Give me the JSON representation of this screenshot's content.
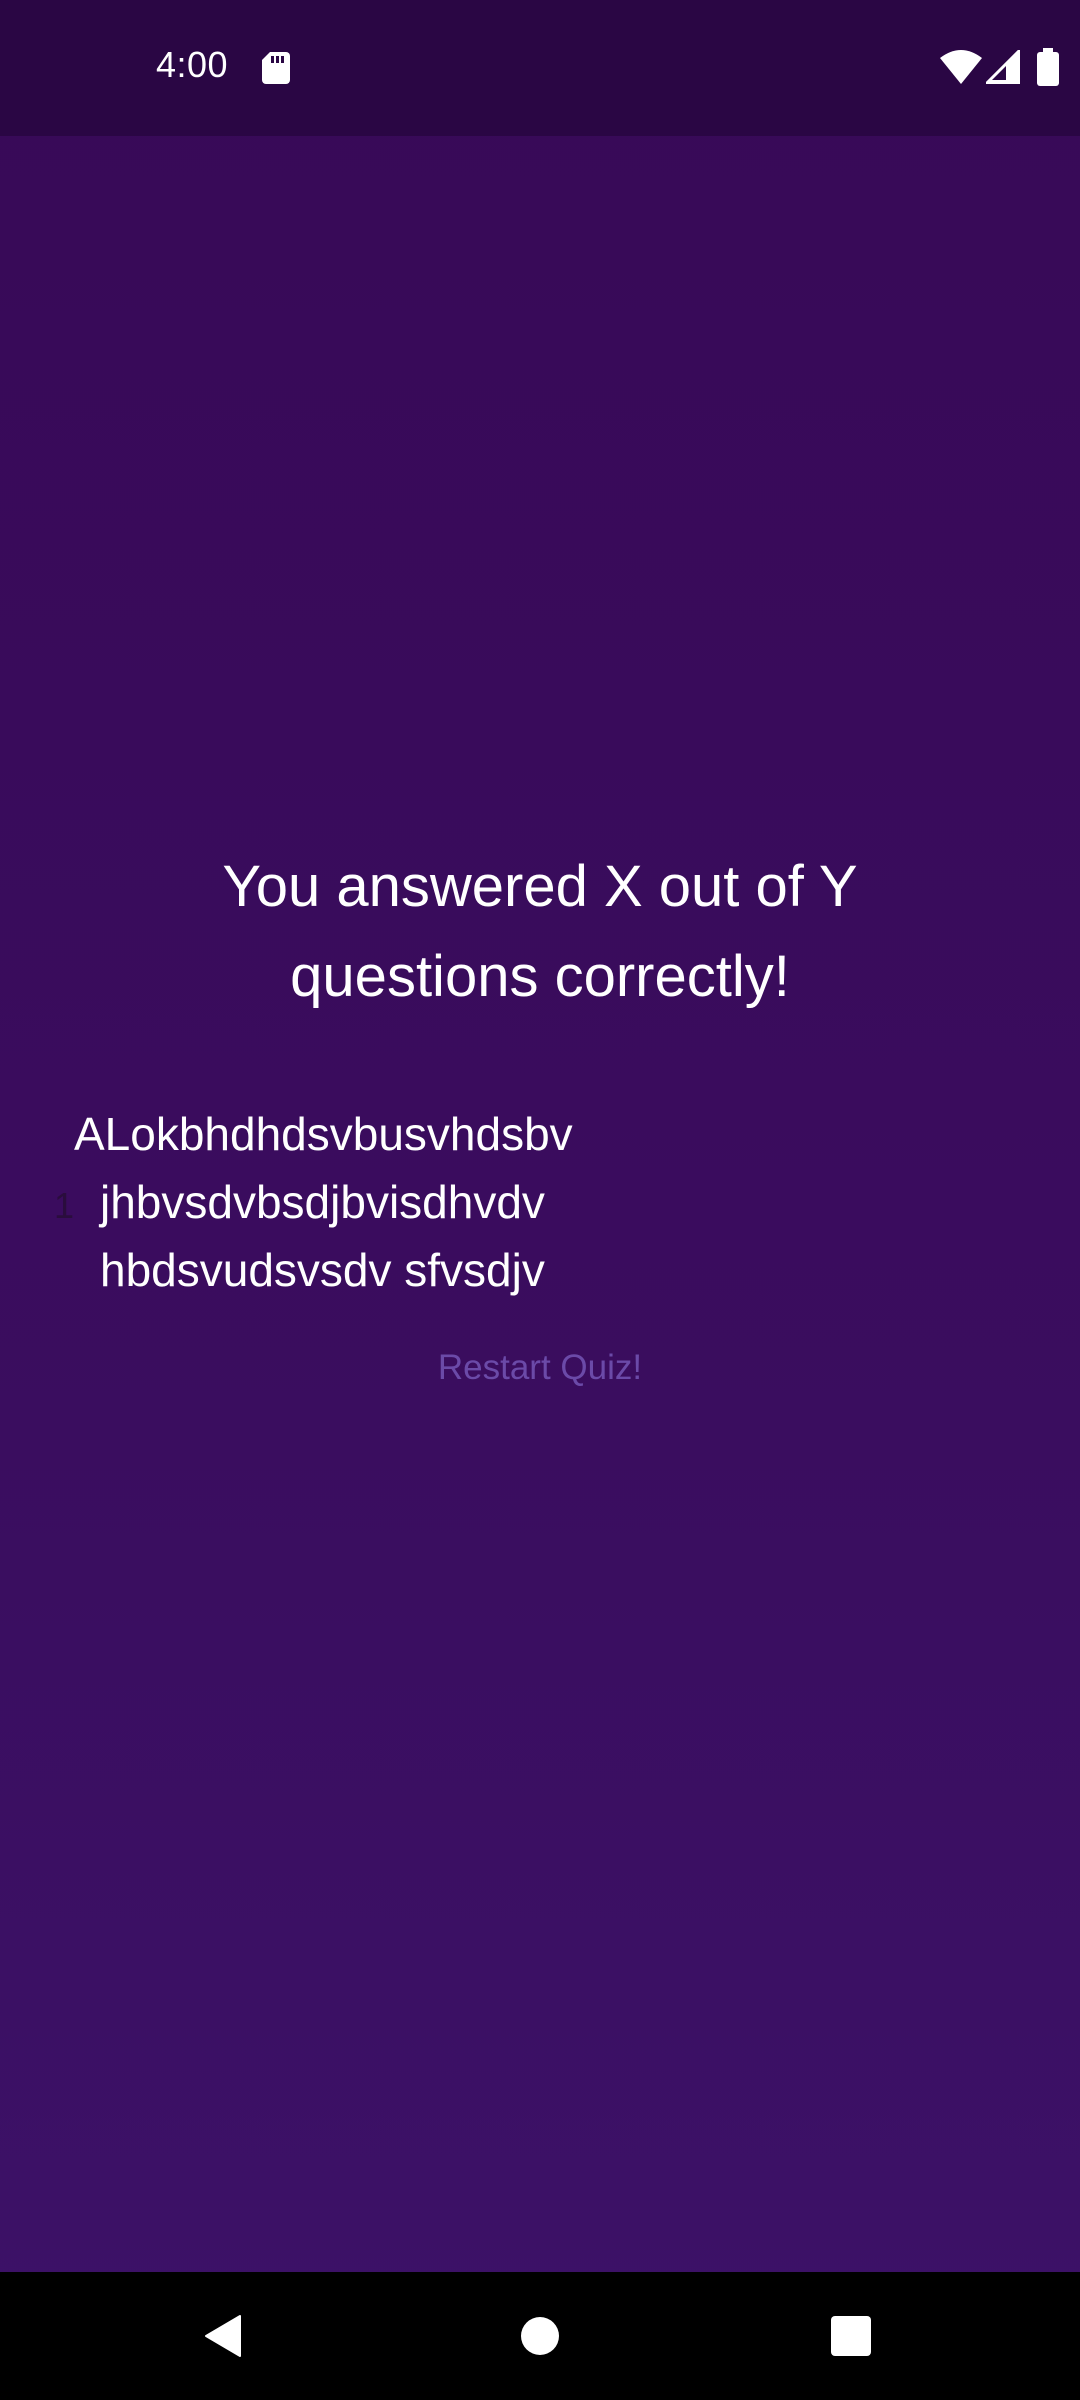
{
  "status_bar": {
    "time": "4:00",
    "icons": [
      "sd-card-icon",
      "wifi-icon",
      "cellular-signal-icon",
      "battery-icon"
    ]
  },
  "result": {
    "title": "You answered X out of Y questions correctly!"
  },
  "answers": [
    {
      "index": "1",
      "line1": "ALokbhdhdsvbusvhdsbv",
      "line2": "jhbvsdvbsdjbvisdhvdv",
      "line3": "hbdsvudsvsdv sfvsdjv"
    }
  ],
  "actions": {
    "restart_label": "Restart Quiz!"
  },
  "nav_bar": {
    "icons": [
      "back-icon",
      "home-icon",
      "recents-icon"
    ]
  },
  "colors": {
    "background": "#380957",
    "status_bar": "#2a0644",
    "restart_text": "#6b4aa8",
    "text": "#ffffff"
  }
}
